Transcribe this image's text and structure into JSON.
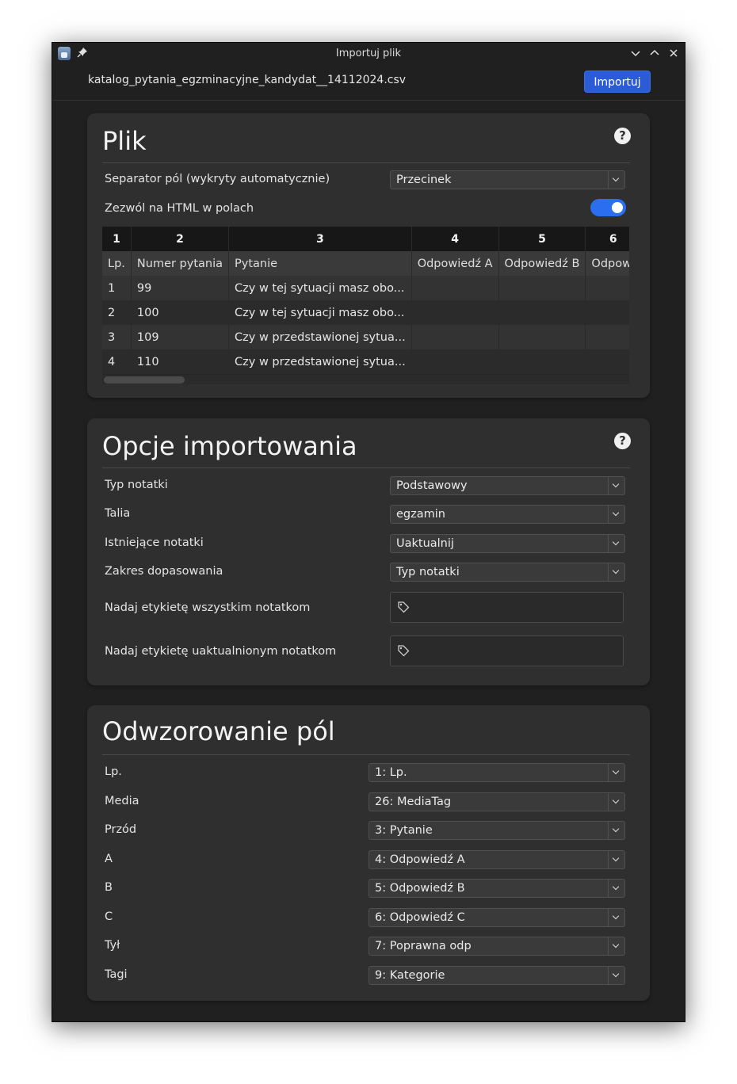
{
  "window": {
    "title": "Importuj plik",
    "file_name": "katalog_pytania_egzminacyjne_kandydat__14112024.csv",
    "import_button": "Importuj"
  },
  "file_section": {
    "heading": "Plik",
    "separator_label": "Separator pól (wykryty automatycznie)",
    "separator_value": "Przecinek",
    "html_label": "Zezwól na HTML w polach",
    "html_enabled": true,
    "table": {
      "col_numbers": [
        "1",
        "2",
        "3",
        "4",
        "5",
        "6"
      ],
      "headers": [
        "Lp.",
        "Numer pytania",
        "Pytanie",
        "Odpowiedź A",
        "Odpowiedź B",
        "Odpowi"
      ],
      "rows": [
        [
          "1",
          "99",
          "Czy w tej sytuacji masz obo...",
          "",
          "",
          ""
        ],
        [
          "2",
          "100",
          "Czy w tej sytuacji masz obo...",
          "",
          "",
          ""
        ],
        [
          "3",
          "109",
          "Czy w przedstawionej sytua...",
          "",
          "",
          ""
        ],
        [
          "4",
          "110",
          "Czy w przedstawionej sytua...",
          "",
          "",
          ""
        ]
      ]
    }
  },
  "import_options": {
    "heading": "Opcje importowania",
    "note_type_label": "Typ notatki",
    "note_type_value": "Podstawowy",
    "deck_label": "Talia",
    "deck_value": "egzamin",
    "existing_label": "Istniejące notatki",
    "existing_value": "Uaktualnij",
    "match_scope_label": "Zakres dopasowania",
    "match_scope_value": "Typ notatki",
    "tag_all_label": "Nadaj etykietę wszystkim notatkom",
    "tag_updated_label": "Nadaj etykietę uaktualnionym notatkom"
  },
  "field_mapping": {
    "heading": "Odwzorowanie pól",
    "fields": [
      {
        "label": "Lp.",
        "value": "1: Lp."
      },
      {
        "label": "Media",
        "value": "26: MediaTag"
      },
      {
        "label": "Przód",
        "value": "3: Pytanie"
      },
      {
        "label": "A",
        "value": "4: Odpowiedź A"
      },
      {
        "label": "B",
        "value": "5: Odpowiedź B"
      },
      {
        "label": "C",
        "value": "6: Odpowiedź C"
      },
      {
        "label": "Tył",
        "value": "7: Poprawna odp"
      },
      {
        "label": "Tagi",
        "value": "9: Kategorie"
      }
    ]
  },
  "colors": {
    "accent": "#2c5bd6",
    "toggle_on": "#2c6ef0",
    "background": "#202020",
    "card": "#2f2f2f"
  },
  "icons": [
    "app-icon",
    "pin-icon",
    "chevron-down-icon",
    "chevron-up-icon",
    "close-icon",
    "help-icon",
    "tag-icon"
  ]
}
